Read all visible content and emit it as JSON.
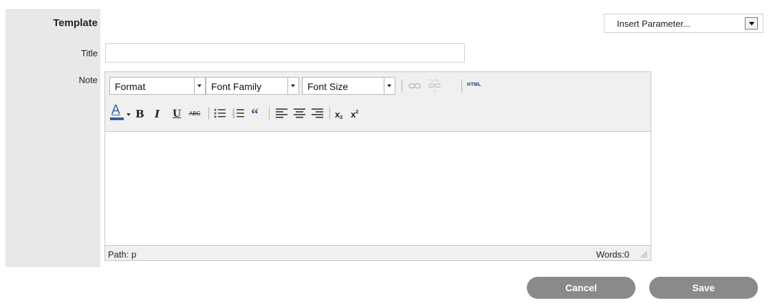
{
  "form": {
    "section_label": "Template",
    "title_label": "Title",
    "note_label": "Note",
    "title_value": "",
    "insert_parameter": "Insert Parameter..."
  },
  "editor": {
    "format_select": "Format",
    "font_family_select": "Font Family",
    "font_size_select": "Font Size",
    "html_label": "HTML",
    "path_text": "Path: p",
    "words_text": "Words:0",
    "text_color_letter": "A",
    "bold_glyph": "B",
    "italic_glyph": "I",
    "underline_glyph": "U",
    "strike_glyph": "ABC",
    "quote_glyph": "“",
    "subscript_glyph": "x",
    "superscript_glyph": "x",
    "text_color_underline": "#2c5fa8",
    "icons": [
      "text-color-icon",
      "bold-icon",
      "italic-icon",
      "underline-icon",
      "strikethrough-icon",
      "bullet-list-icon",
      "numbered-list-icon",
      "blockquote-icon",
      "align-left-icon",
      "align-center-icon",
      "align-right-icon",
      "subscript-icon",
      "superscript-icon",
      "link-icon",
      "unlink-icon"
    ]
  },
  "actions": {
    "cancel_label": "Cancel",
    "save_label": "Save"
  }
}
